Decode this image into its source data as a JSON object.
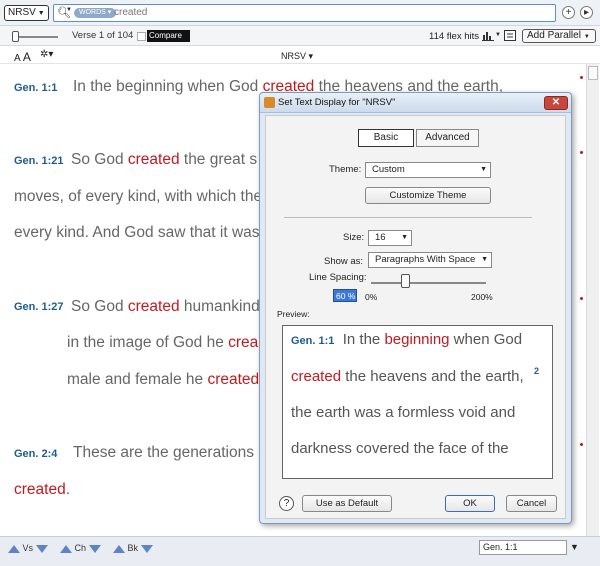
{
  "topbar": {
    "version": "NRSV",
    "search_chip": "WORDS",
    "search_query": "created",
    "add_icon": "plus-circle-icon",
    "nav_icon": "forward-circle-icon"
  },
  "toolbar": {
    "verse_count": "Verse 1 of 104",
    "compare_label": "Compare",
    "hits": "114 flex hits",
    "add_parallel": "Add Parallel"
  },
  "row3": {
    "aa_small": "A",
    "aa_big": "A",
    "column_title": "NRSV"
  },
  "verses": [
    {
      "ref": "Gen. 1:1",
      "lines": [
        {
          "pre": "In the beginning when God ",
          "hl": "created",
          "post": " the heavens and the earth,"
        }
      ]
    },
    {
      "ref": "Gen. 1:21",
      "lines": [
        {
          "pre": "So God ",
          "hl": "created",
          "post": " the great s"
        },
        {
          "pre": "moves, of every kind, with which the",
          "hl": "",
          "post": ""
        },
        {
          "pre": "every kind. And God saw that it was",
          "hl": "",
          "post": ""
        }
      ]
    },
    {
      "ref": "Gen. 1:27",
      "lines": [
        {
          "pre": "So God ",
          "hl": "created",
          "post": " humankind"
        },
        {
          "pre": "in the image of God he ",
          "hl": "crea",
          "post": ""
        },
        {
          "pre": "male and female he ",
          "hl": "created",
          "post": ""
        }
      ]
    },
    {
      "ref": "Gen. 2:4",
      "lines": [
        {
          "pre": "These are the generations c",
          "hl": "",
          "post": ""
        },
        {
          "pre": "",
          "hl": "created",
          "post": "."
        }
      ]
    }
  ],
  "bottombar": {
    "vs": "Vs",
    "ch": "Ch",
    "bk": "Bk",
    "reference": "Gen. 1:1"
  },
  "dialog": {
    "title": "Set Text Display for \"NRSV\"",
    "close_label": "✕",
    "tab_basic": "Basic",
    "tab_advanced": "Advanced",
    "theme_label": "Theme:",
    "theme_value": "Custom",
    "customize_button": "Customize Theme",
    "size_label": "Size:",
    "size_value": "16",
    "show_as_label": "Show as:",
    "show_as_value": "Paragraphs With Space",
    "line_spacing_label": "Line Spacing:",
    "line_spacing_value": "60 %",
    "line_spacing_level": 0.3,
    "line_spacing_min": "0%",
    "line_spacing_max": "200%",
    "preview_label": "Preview:",
    "preview": {
      "ref": "Gen. 1:1",
      "line1_pre": "In the ",
      "line1_hl": "beginning",
      "line1_post": " when God",
      "line2_hl": "created",
      "line2_post": " the heavens and the earth,",
      "sup": "2",
      "line3": "the earth was a formless void and",
      "line4": "darkness covered the face of the"
    },
    "help_label": "?",
    "use_default_button": "Use as Default",
    "ok_button": "OK",
    "cancel_button": "Cancel"
  }
}
